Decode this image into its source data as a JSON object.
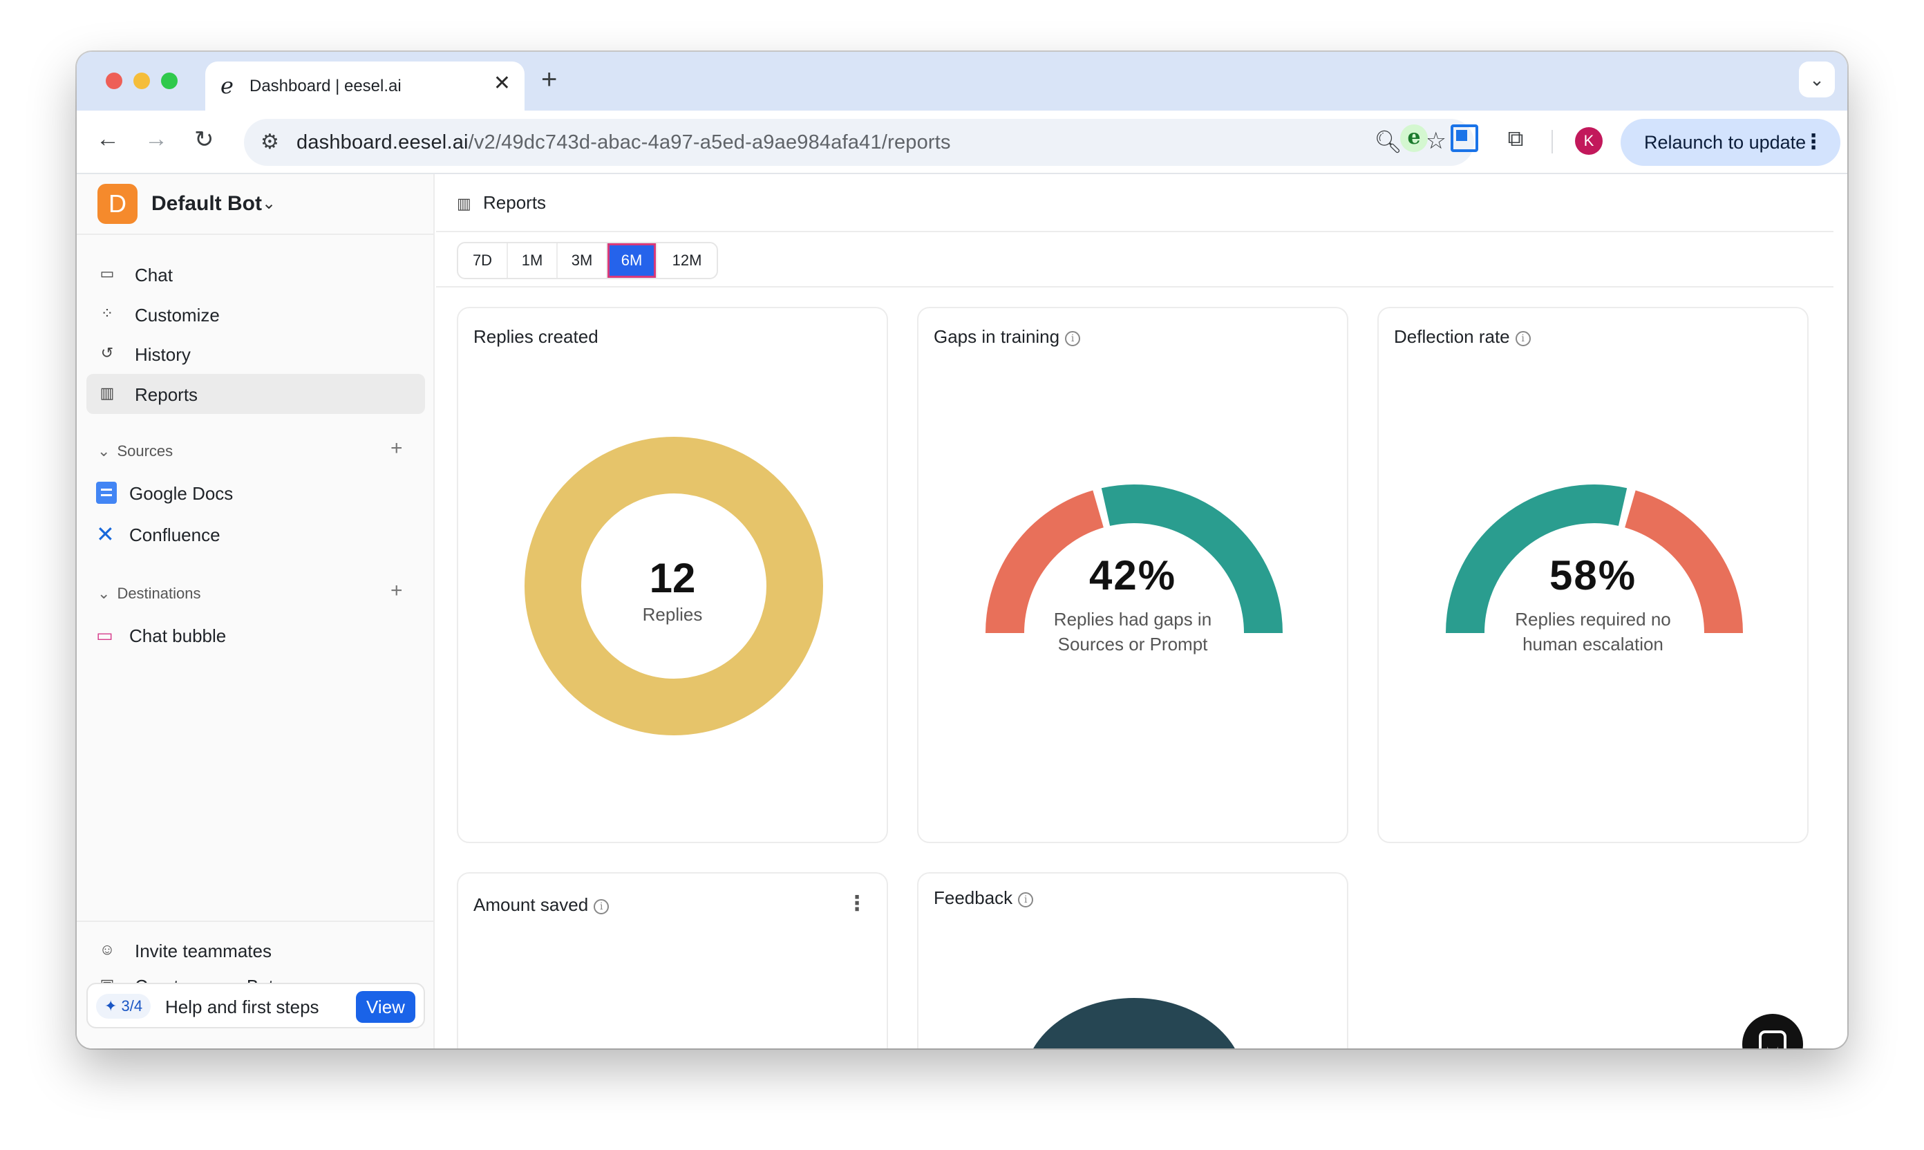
{
  "browser": {
    "tab_title": "Dashboard | eesel.ai",
    "tab_favicon": "e",
    "new_tab": "+",
    "url_host": "dashboard.eesel.ai",
    "url_path": "/v2/49dc743d-abac-4a97-a5ed-a9ae984afa41/reports",
    "profile_initial": "K",
    "relaunch_label": "Relaunch to update",
    "extension_e": "e"
  },
  "sidebar": {
    "bot_initial": "D",
    "bot_name": "Default Bot",
    "nav": [
      {
        "label": "Chat",
        "icon": "chat-icon"
      },
      {
        "label": "Customize",
        "icon": "customize-icon"
      },
      {
        "label": "History",
        "icon": "history-icon"
      },
      {
        "label": "Reports",
        "icon": "reports-icon",
        "active": true
      }
    ],
    "sources_heading": "Sources",
    "sources": [
      {
        "label": "Google Docs",
        "icon": "google-docs-icon"
      },
      {
        "label": "Confluence",
        "icon": "confluence-icon"
      }
    ],
    "destinations_heading": "Destinations",
    "destinations": [
      {
        "label": "Chat bubble",
        "icon": "chat-bubble-icon"
      }
    ],
    "bottom": [
      {
        "label": "Invite teammates",
        "icon": "invite-icon"
      },
      {
        "label": "Create a new Bot",
        "icon": "new-bot-icon"
      }
    ],
    "help": {
      "badge": "3/4",
      "text": "Help and first steps",
      "button": "View"
    }
  },
  "main": {
    "title": "Reports",
    "ranges": [
      "7D",
      "1M",
      "3M",
      "6M",
      "12M"
    ],
    "selected_range": "6M",
    "cards": {
      "replies_created": {
        "title": "Replies created",
        "value": "12",
        "label": "Replies",
        "color": "#e6c46a"
      },
      "gaps": {
        "title": "Gaps in training",
        "value": "42%",
        "label_1": "Replies had gaps in",
        "label_2": "Sources or Prompt",
        "fraction": 0.42,
        "colors": [
          "#e8705a",
          "#2a9d8f"
        ]
      },
      "deflection": {
        "title": "Deflection rate",
        "value": "58%",
        "label_1": "Replies required no",
        "label_2": "human escalation",
        "fraction": 0.58,
        "colors": [
          "#2a9d8f",
          "#e8705a"
        ]
      },
      "amount_saved": {
        "title": "Amount saved"
      },
      "feedback": {
        "title": "Feedback",
        "color": "#264653"
      }
    }
  }
}
